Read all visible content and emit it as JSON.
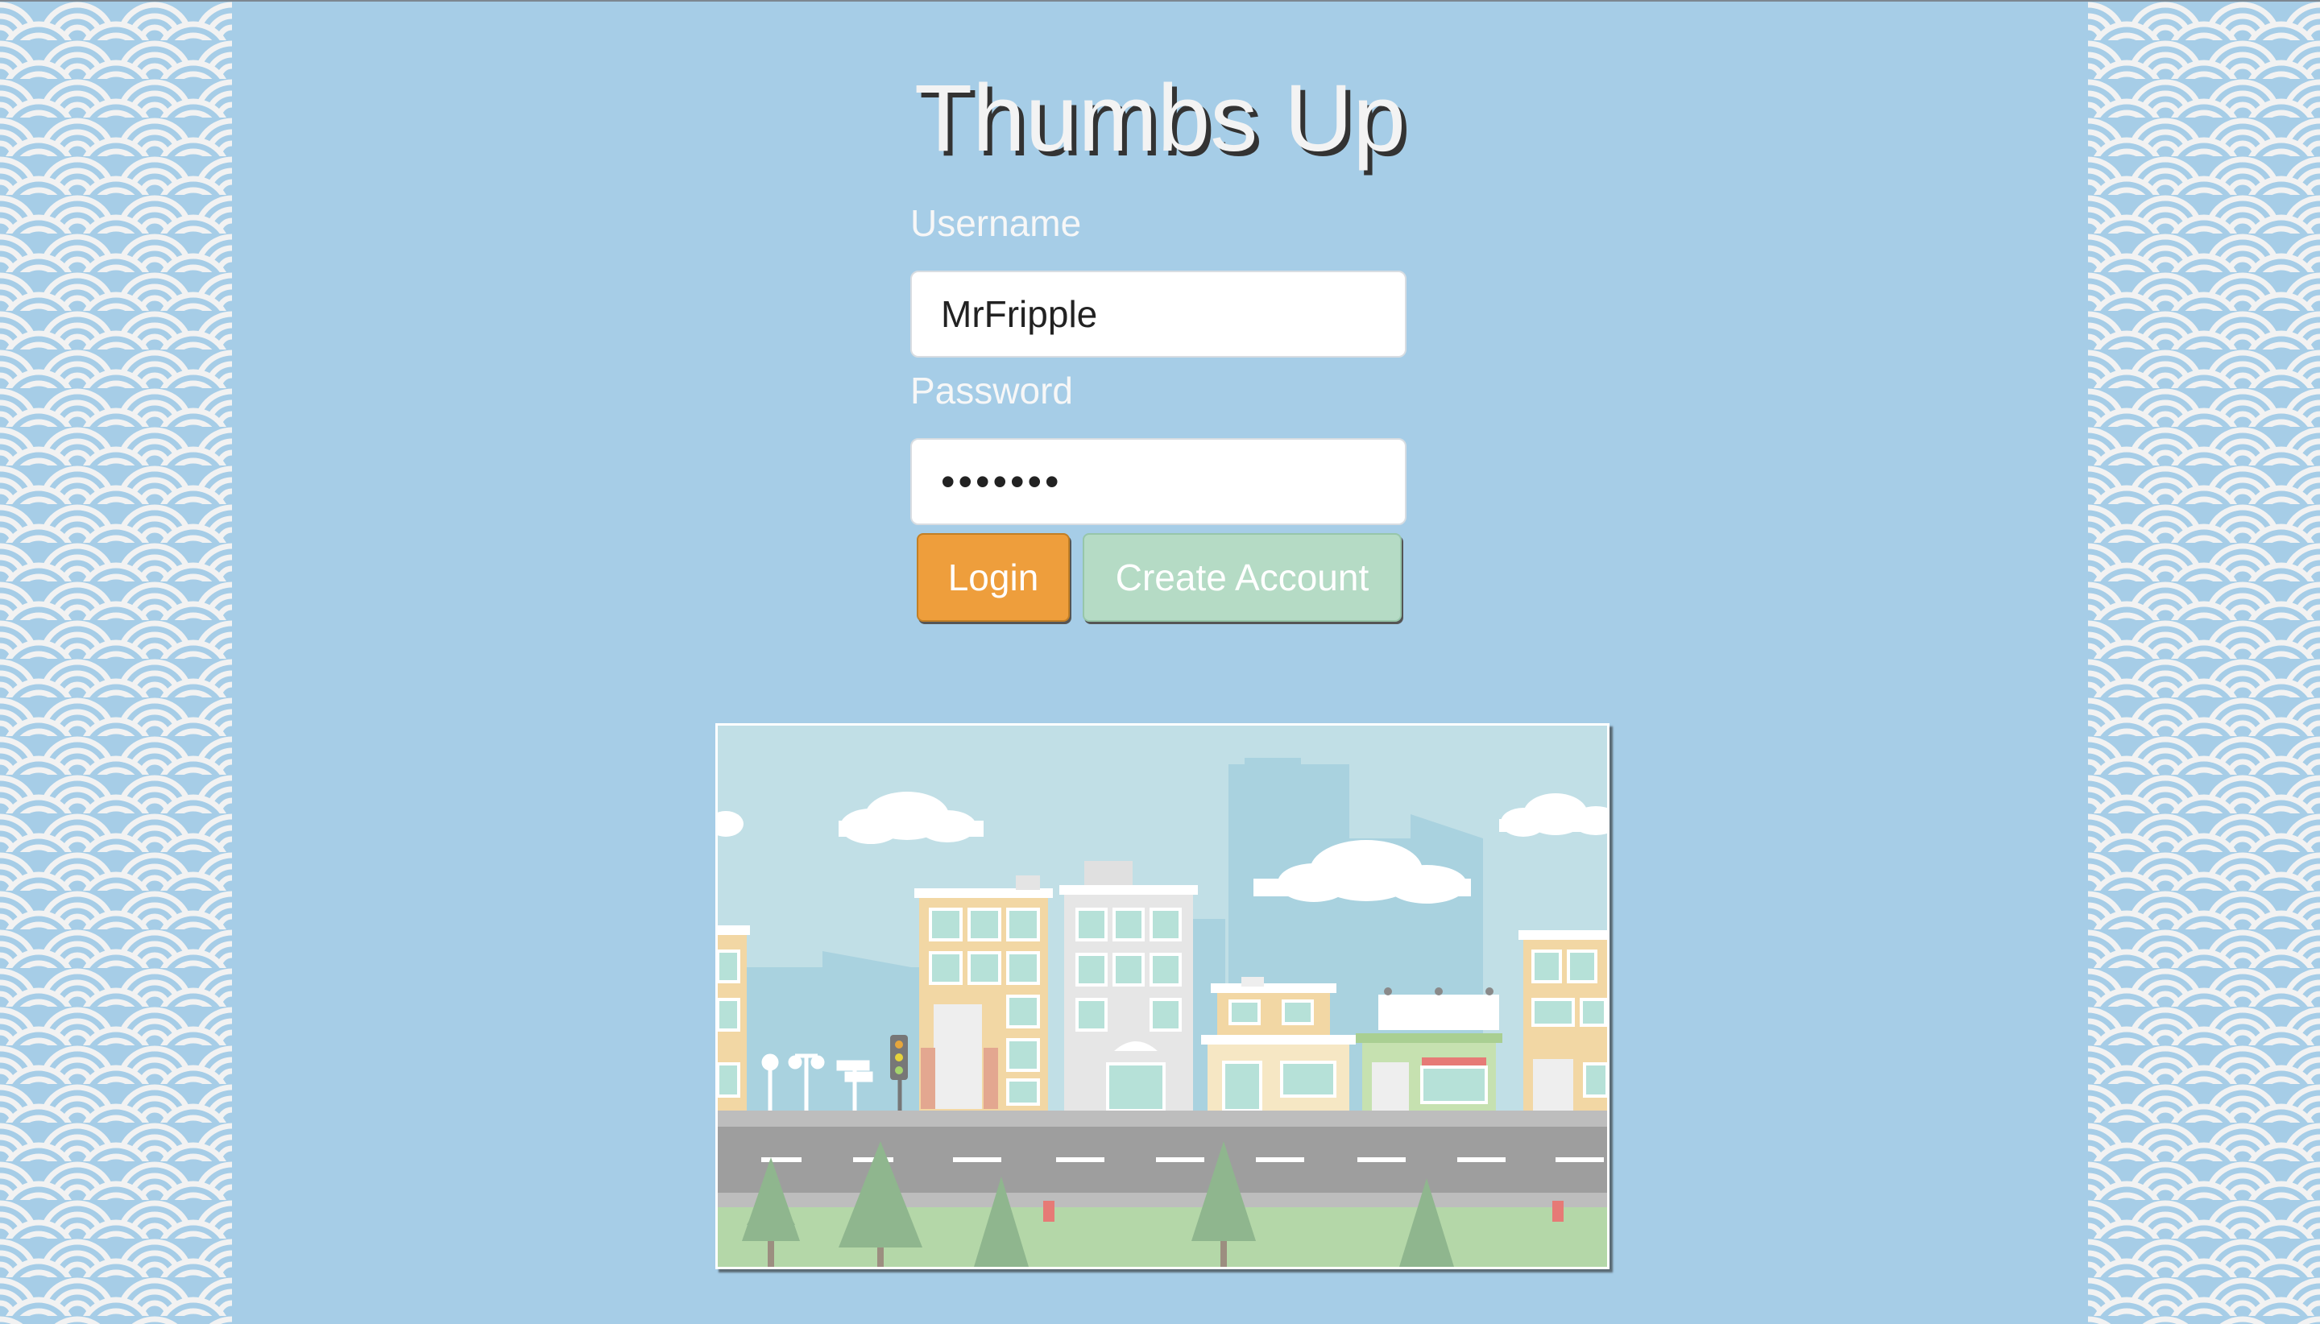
{
  "app": {
    "title": "Thumbs Up"
  },
  "login_form": {
    "username_label": "Username",
    "username_value": "MrFripple",
    "password_label": "Password",
    "password_value": "•••••••"
  },
  "buttons": {
    "login_label": "Login",
    "create_account_label": "Create Account"
  },
  "colors": {
    "background": "#a6cde7",
    "login_button": "#ee9e3c",
    "create_account_button": "#b5dbc5",
    "pattern_light": "#f2f2f2",
    "pattern_blue": "#a6cde7"
  },
  "decor": {
    "side_pattern": "seigaiha-wave-pattern",
    "illustration": "city-street-illustration"
  }
}
